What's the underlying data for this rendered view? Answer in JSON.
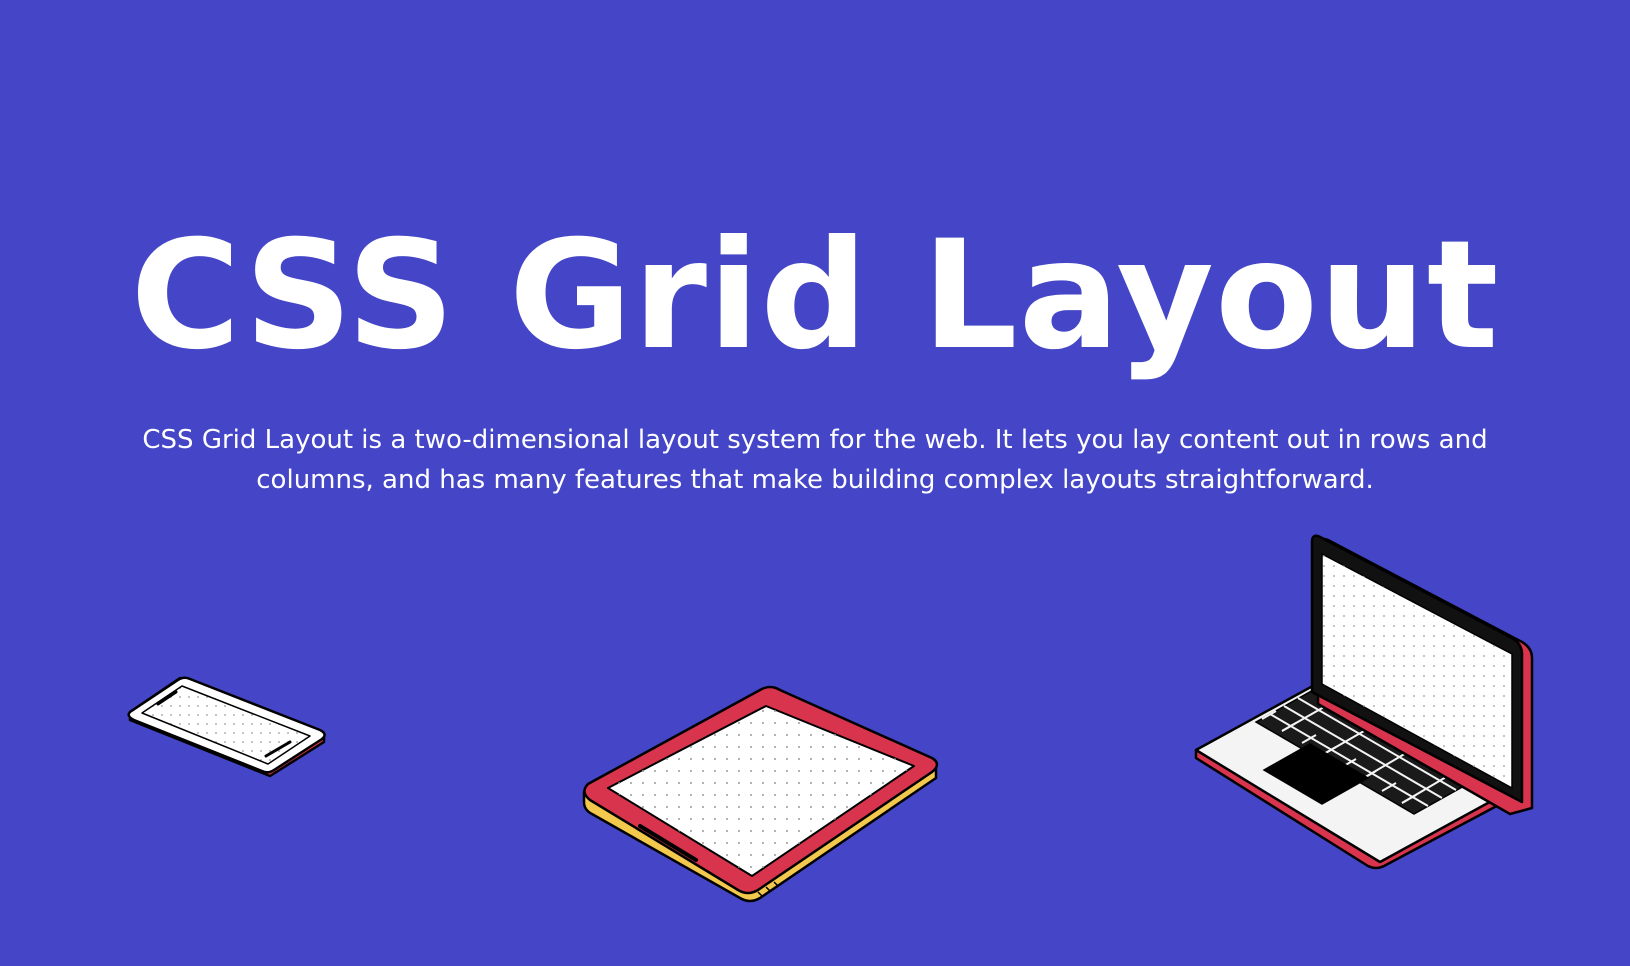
{
  "hero": {
    "title": "CSS Grid Layout",
    "description": "CSS Grid Layout is a two-dimensional layout system for the web. It lets you lay content out in rows and columns, and has many features that make building complex layouts straightforward."
  },
  "illustrations": {
    "icons": [
      "smartphone-icon",
      "tablet-icon",
      "laptop-icon"
    ]
  },
  "colors": {
    "background": "#4446c7",
    "text": "#ffffff",
    "device_accent_red": "#d8344e",
    "device_accent_yellow": "#f2c94c",
    "outline": "#000000"
  }
}
